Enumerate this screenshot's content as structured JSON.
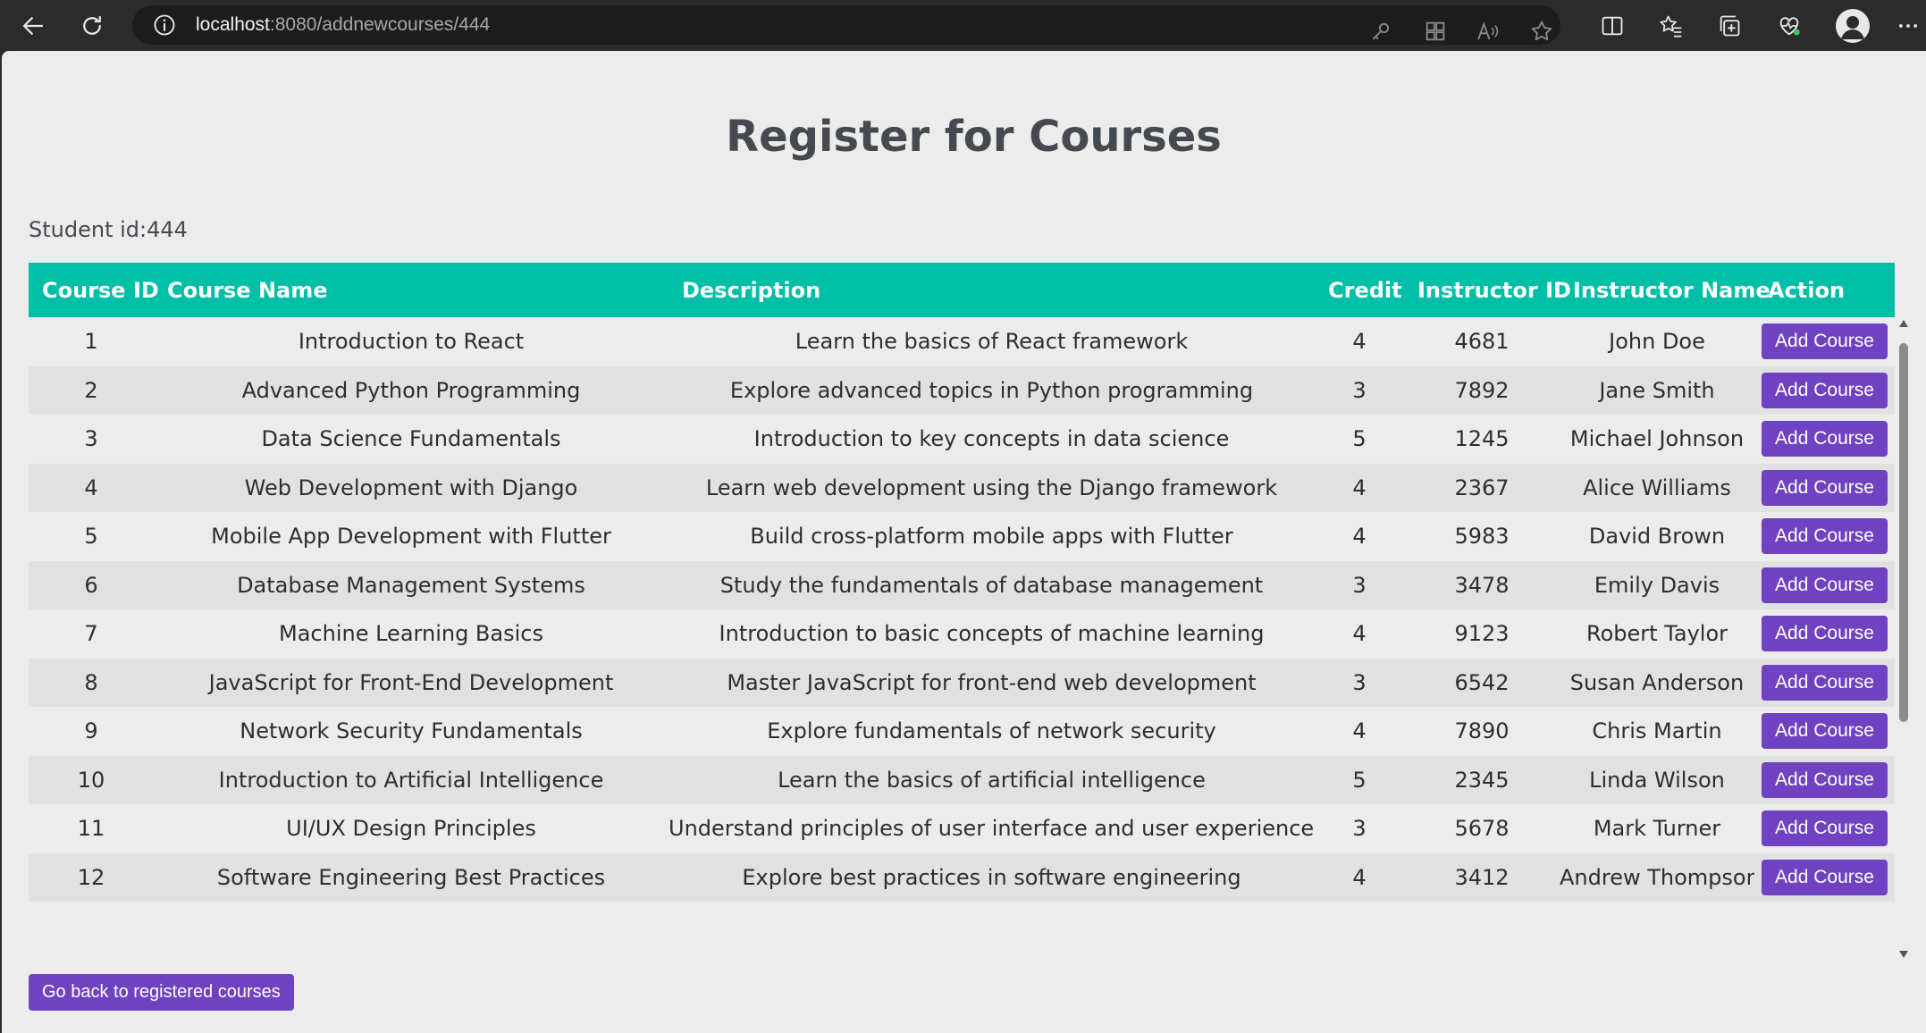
{
  "browser": {
    "url_host": "localhost",
    "url_path": ":8080/addnewcourses/444"
  },
  "page": {
    "title": "Register for Courses",
    "student_label": "Student id:444"
  },
  "table": {
    "headers": [
      "Course ID",
      "Course Name",
      "Description",
      "Credit",
      "Instructor ID",
      "Instructor Name",
      "Action"
    ],
    "action_label": "Add Course",
    "rows": [
      {
        "id": "1",
        "name": "Introduction to React",
        "description": "Learn the basics of React framework",
        "credit": "4",
        "instructor_id": "4681",
        "instructor_name": "John Doe"
      },
      {
        "id": "2",
        "name": "Advanced Python Programming",
        "description": "Explore advanced topics in Python programming",
        "credit": "3",
        "instructor_id": "7892",
        "instructor_name": "Jane Smith"
      },
      {
        "id": "3",
        "name": "Data Science Fundamentals",
        "description": "Introduction to key concepts in data science",
        "credit": "5",
        "instructor_id": "1245",
        "instructor_name": "Michael Johnson"
      },
      {
        "id": "4",
        "name": "Web Development with Django",
        "description": "Learn web development using the Django framework",
        "credit": "4",
        "instructor_id": "2367",
        "instructor_name": "Alice Williams"
      },
      {
        "id": "5",
        "name": "Mobile App Development with Flutter",
        "description": "Build cross-platform mobile apps with Flutter",
        "credit": "4",
        "instructor_id": "5983",
        "instructor_name": "David Brown"
      },
      {
        "id": "6",
        "name": "Database Management Systems",
        "description": "Study the fundamentals of database management",
        "credit": "3",
        "instructor_id": "3478",
        "instructor_name": "Emily Davis"
      },
      {
        "id": "7",
        "name": "Machine Learning Basics",
        "description": "Introduction to basic concepts of machine learning",
        "credit": "4",
        "instructor_id": "9123",
        "instructor_name": "Robert Taylor"
      },
      {
        "id": "8",
        "name": "JavaScript for Front-End Development",
        "description": "Master JavaScript for front-end web development",
        "credit": "3",
        "instructor_id": "6542",
        "instructor_name": "Susan Anderson"
      },
      {
        "id": "9",
        "name": "Network Security Fundamentals",
        "description": "Explore fundamentals of network security",
        "credit": "4",
        "instructor_id": "7890",
        "instructor_name": "Chris Martin"
      },
      {
        "id": "10",
        "name": "Introduction to Artificial Intelligence",
        "description": "Learn the basics of artificial intelligence",
        "credit": "5",
        "instructor_id": "2345",
        "instructor_name": "Linda Wilson"
      },
      {
        "id": "11",
        "name": "UI/UX Design Principles",
        "description": "Understand principles of user interface and user experience design",
        "credit": "3",
        "instructor_id": "5678",
        "instructor_name": "Mark Turner"
      },
      {
        "id": "12",
        "name": "Software Engineering Best Practices",
        "description": "Explore best practices in software engineering",
        "credit": "4",
        "instructor_id": "3412",
        "instructor_name": "Andrew Thompson"
      }
    ]
  },
  "footer": {
    "back_label": "Go back to registered courses"
  },
  "colors": {
    "header_bg": "#00bfa6",
    "button_bg": "#6f42c1",
    "page_bg": "#ececec",
    "chrome_bg": "#2b2b2b"
  },
  "icons": {
    "back": "back-arrow-icon",
    "reload": "reload-icon",
    "info": "info-icon",
    "key": "key-icon",
    "apps": "apps-icon",
    "read_aloud": "read-aloud-icon",
    "favorite": "star-icon",
    "split": "split-screen-icon",
    "favorites": "favorites-icon",
    "collections": "collections-icon",
    "health": "heart-pulse-icon",
    "profile": "profile-icon",
    "more": "more-icon"
  }
}
